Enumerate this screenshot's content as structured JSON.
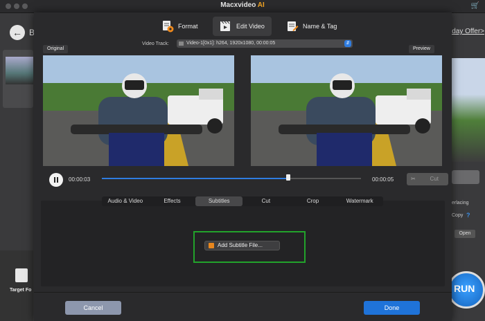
{
  "app": {
    "title_main": "Macxvideo",
    "title_accent": "AI"
  },
  "background": {
    "back_partial": "B",
    "holiday_offer": "iday Offer>",
    "interlacing": "erlacing",
    "copy": "Copy",
    "help": "?",
    "open": "Open",
    "run": "RUN",
    "target_format": "Target Fo"
  },
  "tabs": [
    {
      "label": "Format",
      "icon": "format-gear-icon"
    },
    {
      "label": "Edit Video",
      "icon": "edit-video-clapper-icon"
    },
    {
      "label": "Name & Tag",
      "icon": "name-tag-icon"
    }
  ],
  "video_track": {
    "label": "Video Track:",
    "value": "Video-1[0x1]: h264, 1920x1080, 00:00:05"
  },
  "panes": {
    "original": "Original",
    "preview": "Preview"
  },
  "player": {
    "current_time": "00:00:03",
    "end_time": "00:00:05",
    "progress": 0.72,
    "cut_label": "Cut"
  },
  "edit_tabs": [
    "Audio & Video",
    "Effects",
    "Subtitles",
    "Cut",
    "Crop",
    "Watermark"
  ],
  "active_edit_tab": "Subtitles",
  "subtitles": {
    "add_button": "Add Subtitle File..."
  },
  "footer": {
    "cancel": "Cancel",
    "done": "Done"
  },
  "colors": {
    "accent": "#f5a623",
    "primary": "#1f73d9",
    "highlight": "#22a32b"
  }
}
